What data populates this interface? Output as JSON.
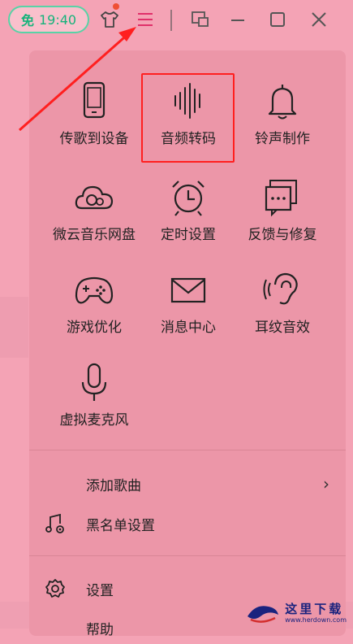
{
  "topbar": {
    "vip_badge": "免",
    "vip_time": "19:40",
    "icons": [
      "shirt-icon",
      "menu-icon",
      "mini-player-icon",
      "minimize-icon",
      "maximize-icon",
      "close-icon"
    ],
    "accent": "#e0306a",
    "vip_color": "#16b37b"
  },
  "grid": [
    {
      "label": "传歌到设备",
      "icon": "phone-icon"
    },
    {
      "label": "音频转码",
      "icon": "waveform-icon"
    },
    {
      "label": "铃声制作",
      "icon": "bell-icon"
    },
    {
      "label": "微云音乐网盘",
      "icon": "cloud-icon"
    },
    {
      "label": "定时设置",
      "icon": "alarm-clock-icon"
    },
    {
      "label": "反馈与修复",
      "icon": "feedback-icon"
    },
    {
      "label": "游戏优化",
      "icon": "gamepad-icon"
    },
    {
      "label": "消息中心",
      "icon": "mail-icon"
    },
    {
      "label": "耳纹音效",
      "icon": "ear-icon"
    },
    {
      "label": "虚拟麦克风",
      "icon": "microphone-icon"
    }
  ],
  "list": [
    {
      "label": "添加歌曲",
      "chevron": "›"
    },
    {
      "label": "黑名单设置",
      "icon": "music-gear-icon"
    },
    {
      "label": "设置",
      "icon": "gear-icon"
    },
    {
      "label": "帮助"
    }
  ],
  "watermark": {
    "title": "这里下载",
    "sub": "www.herdown.com"
  },
  "colors": {
    "background": "#f4a3b5",
    "menu": "#ec96a8",
    "highlight": "#ff1f1f",
    "arrow": "#ff1f1f"
  }
}
